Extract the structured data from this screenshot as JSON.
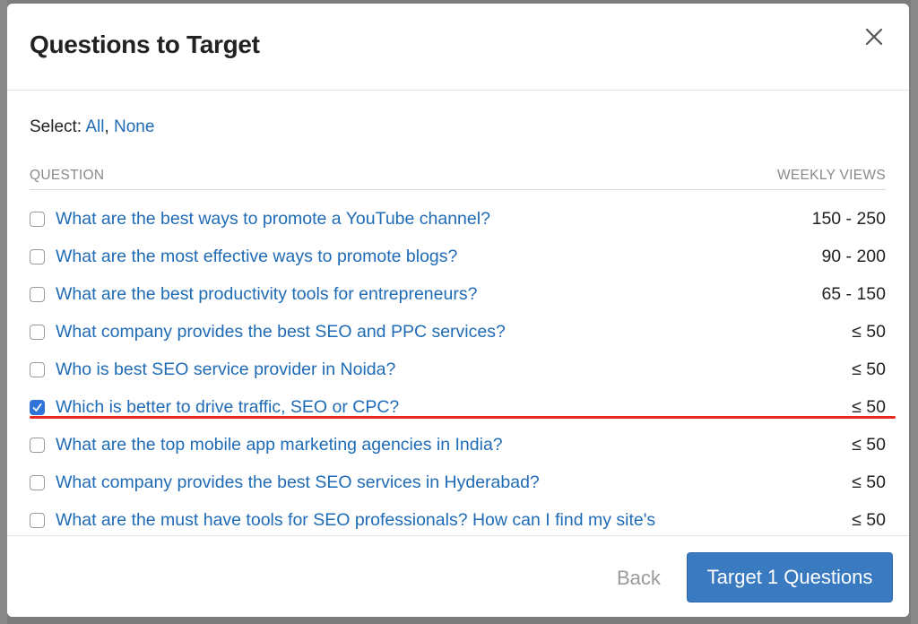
{
  "modal": {
    "title": "Questions to Target"
  },
  "select": {
    "label": "Select:",
    "all": "All",
    "separator": ",",
    "none": "None"
  },
  "table": {
    "col_question": "QUESTION",
    "col_views": "WEEKLY VIEWS",
    "rows": [
      {
        "question": "What are the best ways to promote a YouTube channel?",
        "views": "150 - 250",
        "checked": false
      },
      {
        "question": "What are the most effective ways to promote blogs?",
        "views": "90 - 200",
        "checked": false
      },
      {
        "question": "What are the best productivity tools for entrepreneurs?",
        "views": "65 - 150",
        "checked": false
      },
      {
        "question": "What company provides the best SEO and PPC services?",
        "views": "≤ 50",
        "checked": false
      },
      {
        "question": "Who is best SEO service provider in Noida?",
        "views": "≤ 50",
        "checked": false
      },
      {
        "question": "Which is better to drive traffic, SEO or CPC?",
        "views": "≤ 50",
        "checked": true
      },
      {
        "question": "What are the top mobile app marketing agencies in India?",
        "views": "≤ 50",
        "checked": false
      },
      {
        "question": "What company provides the best SEO services in Hyderabad?",
        "views": "≤ 50",
        "checked": false
      },
      {
        "question": "What are the must have tools for SEO professionals? How can I find my site's",
        "views": "≤ 50",
        "checked": false
      }
    ]
  },
  "footer": {
    "back_label": "Back",
    "target_label": "Target 1 Questions"
  },
  "colors": {
    "link": "#1f6bb5",
    "primary_button": "#3a7ac0",
    "highlight": "#e8281e",
    "checkbox_checked": "#2f74d8"
  },
  "icons": {
    "close": "close-icon",
    "check": "checkmark-icon"
  }
}
